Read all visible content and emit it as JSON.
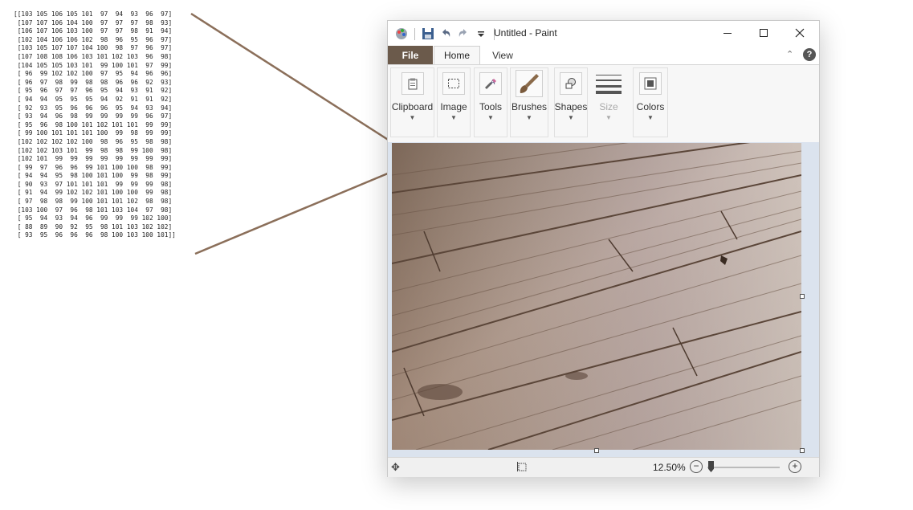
{
  "matrix": {
    "rows": [
      "[[103 105 106 105 101  97  94  93  96  97]",
      " [107 107 106 104 100  97  97  97  98  93]",
      " [106 107 106 103 100  97  97  98  91  94]",
      " [102 104 106 106 102  98  96  95  96  97]",
      " [103 105 107 107 104 100  98  97  96  97]",
      " [107 108 108 106 103 101 102 103  96  98]",
      " [104 105 105 103 101  99 100 101  97  99]",
      " [ 96  99 102 102 100  97  95  94  96  96]",
      " [ 96  97  98  99  98  98  96  96  92  93]",
      " [ 95  96  97  97  96  95  94  93  91  92]",
      " [ 94  94  95  95  95  94  92  91  91  92]",
      " [ 92  93  95  96  96  96  95  94  93  94]",
      " [ 93  94  96  98  99  99  99  99  96  97]",
      " [ 95  96  98 100 101 102 101 101  99  99]",
      " [ 99 100 101 101 101 100  99  98  99  99]",
      " [102 102 102 102 100  98  96  95  98  98]",
      " [102 102 103 101  99  98  98  99 100  98]",
      " [102 101  99  99  99  99  99  99  99  99]",
      " [ 99  97  96  96  99 101 100 100  98  99]",
      " [ 94  94  95  98 100 101 100  99  98  99]",
      " [ 90  93  97 101 101 101  99  99  99  98]",
      " [ 91  94  99 102 102 101 100 100  99  98]",
      " [ 97  98  98  99 100 101 101 102  98  98]",
      " [103 100  97  96  98 101 103 104  97  98]",
      " [ 95  94  93  94  96  99  99  99 102 100]",
      " [ 88  89  90  92  95  98 101 103 102 102]",
      " [ 93  95  96  96  96  98 100 103 100 101]]"
    ]
  },
  "window": {
    "title": "Untitled - Paint",
    "tabs": {
      "file": "File",
      "home": "Home",
      "view": "View"
    },
    "help": "?",
    "groups": {
      "clipboard": "Clipboard",
      "image": "Image",
      "tools": "Tools",
      "brushes": "Brushes",
      "shapes": "Shapes",
      "size": "Size",
      "colors": "Colors"
    },
    "status": {
      "zoom": "12.50%",
      "zoom_out": "−",
      "zoom_in": "+",
      "zoom_level": 0.05
    },
    "colors": {
      "file_tab": "#6b5a4b",
      "canvas_bg": "#dbe3ee",
      "connector": "#8b6f5a"
    }
  }
}
